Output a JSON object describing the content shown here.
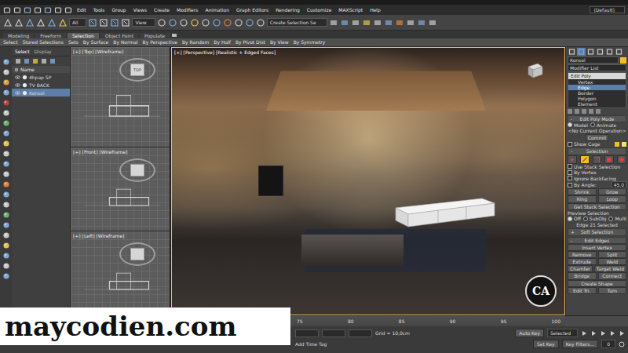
{
  "menu": {
    "items": [
      "Edit",
      "Tools",
      "Group",
      "Views",
      "Create",
      "Modifiers",
      "Animation",
      "Graph Editors",
      "Rendering",
      "Customize",
      "MAXScript",
      "Help"
    ],
    "workspace": "(Default)"
  },
  "toolbar": {
    "filter": "All",
    "coordinate_system": "View",
    "selection_set": "Create Selection Se"
  },
  "ribbon": {
    "tabs": [
      {
        "label": "Modeling",
        "selected": false
      },
      {
        "label": "Freeform",
        "selected": false
      },
      {
        "label": "Selection",
        "selected": true
      },
      {
        "label": "Object Paint",
        "selected": false
      },
      {
        "label": "Populate",
        "selected": false
      }
    ],
    "items": [
      "Select",
      "Stored Selections",
      "Sets",
      "By Surface",
      "By Normal",
      "By Perspective",
      "By Random",
      "By Half",
      "By Pivot Dist",
      "By View",
      "By Symmetry"
    ]
  },
  "scene_explorer": {
    "tabs": [
      {
        "label": "Select",
        "selected": true
      },
      {
        "label": "Display",
        "selected": false
      }
    ],
    "column": "Name",
    "items": [
      {
        "label": "4hpap SP",
        "selected": false
      },
      {
        "label": "TV BACK",
        "selected": false
      },
      {
        "label": "Konsol",
        "selected": true
      }
    ]
  },
  "viewports": [
    {
      "label": "[+] [Top] [Wireframe]",
      "cube": "TOP"
    },
    {
      "label": "[+] [Front] [Wireframe]"
    },
    {
      "label": "[+] [Left] [Wireframe]"
    }
  ],
  "perspective": {
    "label": "[+] [Perspective] [Realistic + Edged Faces]",
    "logo": "CA"
  },
  "command_panel": {
    "object_name": "Konsol",
    "modifier_list": "Modifier List",
    "stack": [
      {
        "label": "Edit Poly",
        "kind": "modifier",
        "selected": false
      },
      {
        "label": "Vertex",
        "kind": "subobject",
        "selected": false
      },
      {
        "label": "Edge",
        "kind": "subobject",
        "selected": true
      },
      {
        "label": "Border",
        "kind": "subobject",
        "selected": false
      },
      {
        "label": "Polygon",
        "kind": "subobject",
        "selected": false
      },
      {
        "label": "Element",
        "kind": "subobject",
        "selected": false
      }
    ],
    "edit_poly_mode": {
      "sign": "-",
      "title": "Edit Poly Mode",
      "modes": [
        {
          "label": "Model",
          "selected": true
        },
        {
          "label": "Animate",
          "selected": false
        }
      ],
      "operation": "<No Current Operation>",
      "commit": "Commit",
      "show_cage": {
        "label": "Show Cage",
        "checked": false
      }
    },
    "selection": {
      "sign": "-",
      "title": "Selection",
      "subobjects": [
        {
          "kind": "vertex",
          "selected": false
        },
        {
          "kind": "edge",
          "selected": true
        },
        {
          "kind": "border",
          "selected": false
        },
        {
          "kind": "polygon",
          "selected": false
        },
        {
          "kind": "element",
          "selected": false
        }
      ],
      "options": [
        {
          "label": "Use Stack Selection",
          "checked": false
        },
        {
          "label": "By Vertex",
          "checked": false
        },
        {
          "label": "Ignore Backfacing",
          "checked": false
        },
        {
          "label": "By Angle:",
          "checked": false,
          "value": "45.0"
        }
      ],
      "buttons": [
        [
          "Shrink",
          "Grow"
        ],
        [
          "Ring",
          "Loop"
        ]
      ],
      "get_stack": "Get Stack Selection",
      "preview": {
        "title": "Preview Selection",
        "options": [
          {
            "label": "Off",
            "selected": true
          },
          {
            "label": "SubObj",
            "selected": false
          },
          {
            "label": "Multi",
            "selected": false
          }
        ]
      },
      "status": "Edge 21 Selected"
    },
    "soft_selection": {
      "sign": "+",
      "title": "Soft Selection"
    },
    "edit_edges": {
      "sign": "-",
      "title": "Edit Edges",
      "buttons": [
        [
          "Insert Vertex"
        ],
        [
          "Remove",
          "Split"
        ],
        [
          "Extrude",
          "Weld"
        ],
        [
          "Chamfer",
          "Target Weld"
        ],
        [
          "Bridge",
          "Connect"
        ],
        [
          "Create Shape"
        ],
        [
          "Edit Tri.",
          "Turn"
        ]
      ]
    }
  },
  "timeline": {
    "ticks": [
      "75",
      "80",
      "85",
      "90",
      "95",
      "100"
    ]
  },
  "status_bar": {
    "grid": "Grid = 10,0cm",
    "add_time_tag": "Add Time Tag",
    "auto_key": "Auto Key",
    "key_mode": "Selected",
    "set_key": "Set Key",
    "key_filters": "Key Filters...",
    "frame": "0"
  },
  "watermark": "maycodien.com"
}
